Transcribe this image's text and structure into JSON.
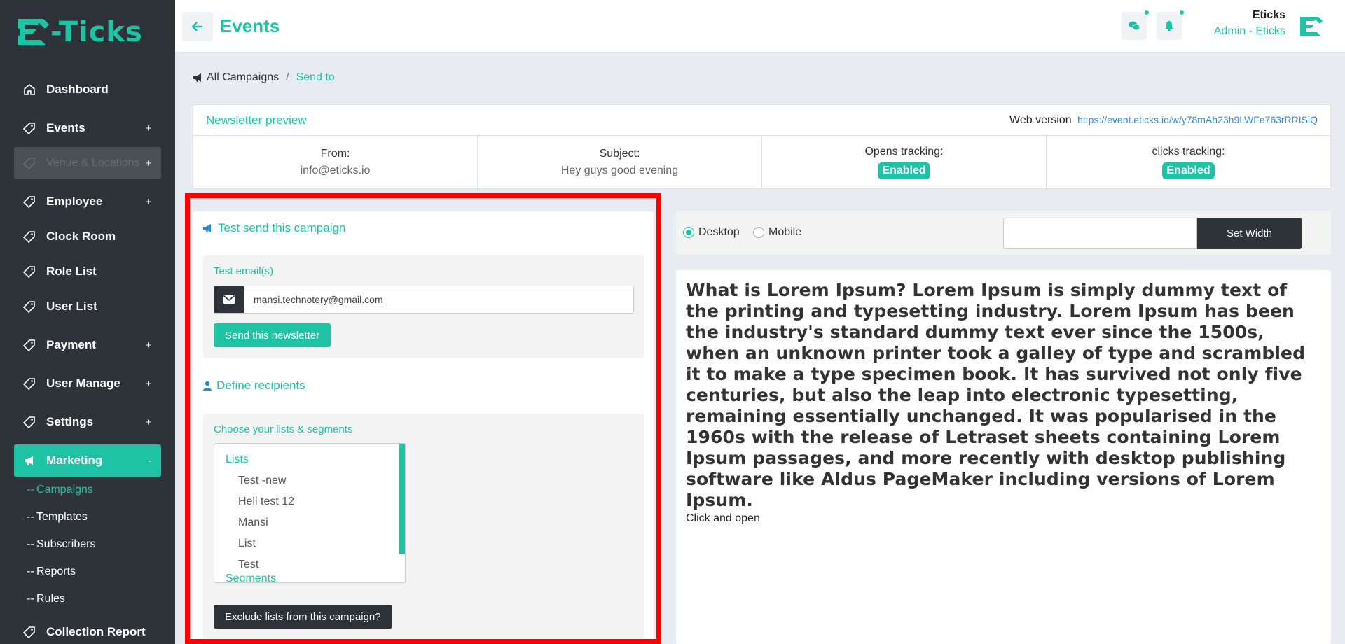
{
  "app": {
    "logo_text": "-Ticks"
  },
  "sidebar": {
    "items": [
      {
        "label": "Dashboard",
        "icon": "home-icon",
        "sign": ""
      },
      {
        "label": "Events",
        "icon": "tag-icon",
        "sign": "+"
      },
      {
        "label": "Venue & Locations",
        "icon": "tag-icon",
        "sign": "+"
      },
      {
        "label": "Employee",
        "icon": "tag-icon",
        "sign": "+"
      },
      {
        "label": "Clock Room",
        "icon": "tag-icon",
        "sign": ""
      },
      {
        "label": "Role List",
        "icon": "tag-icon",
        "sign": ""
      },
      {
        "label": "User List",
        "icon": "tag-icon",
        "sign": ""
      },
      {
        "label": "Payment",
        "icon": "tag-icon",
        "sign": "+"
      },
      {
        "label": "User Manage",
        "icon": "tag-icon",
        "sign": "+"
      },
      {
        "label": "Settings",
        "icon": "tag-icon",
        "sign": "+"
      },
      {
        "label": "Marketing",
        "icon": "megaphone-icon",
        "sign": "-"
      },
      {
        "label": "Collection Report",
        "icon": "tag-icon",
        "sign": ""
      }
    ],
    "sub_items": [
      {
        "dash": "--",
        "label": "Campaigns"
      },
      {
        "dash": "--",
        "label": "Templates"
      },
      {
        "dash": "--",
        "label": "Subscribers"
      },
      {
        "dash": "--",
        "label": "Reports"
      },
      {
        "dash": "--",
        "label": "Rules"
      }
    ]
  },
  "header": {
    "title": "Events",
    "user_name": "Eticks",
    "user_role": "Admin - Eticks"
  },
  "breadcrumb": {
    "root": "All Campaigns",
    "sep": "/",
    "current": "Send to"
  },
  "preview_card": {
    "title": "Newsletter preview",
    "web_label": "Web version",
    "web_url": "https://event.eticks.io/w/y78mAh23h9LWFe763rRRISiQ",
    "from_label": "From:",
    "from_value": "info@eticks.io",
    "subject_label": "Subject:",
    "subject_value": "Hey guys good evening",
    "opens_label": "Opens tracking:",
    "opens_value": "Enabled",
    "clicks_label": "clicks tracking:",
    "clicks_value": "Enabled"
  },
  "test_send": {
    "title": "Test send this campaign",
    "email_label": "Test email(s)",
    "email_value": "mansi.technotery@gmail.com",
    "send_button": "Send this newsletter"
  },
  "recipients": {
    "title": "Define recipients",
    "choose_label": "Choose your lists & segments",
    "lists_group": "Lists",
    "lists": [
      "Test -new",
      "Heli test 12",
      "Mansi",
      "List",
      "Test"
    ],
    "segments_group": "Segments",
    "exclude_button": "Exclude lists from this campaign?"
  },
  "view_toolbar": {
    "desktop_label": "Desktop",
    "mobile_label": "Mobile",
    "selected": "Desktop",
    "width_value": "",
    "set_width_button": "Set Width"
  },
  "preview_body": {
    "heading": "What is Lorem Ipsum? Lorem Ipsum is simply dummy text of the printing and typesetting industry. Lorem Ipsum has been the industry's standard dummy text ever since the 1500s, when an unknown printer took a galley of type and scrambled it to make a type specimen book. It has survived not only five centuries, but also the leap into electronic typesetting, remaining essentially unchanged. It was popularised in the 1960s with the release of Letraset sheets containing Lorem Ipsum passages, and more recently with desktop publishing software like Aldus PageMaker including versions of Lorem Ipsum.",
    "link_text": "Click and open"
  },
  "colors": {
    "accent": "#1ec3a6",
    "sidebar": "#2d3338",
    "highlight": "#ff0000"
  }
}
